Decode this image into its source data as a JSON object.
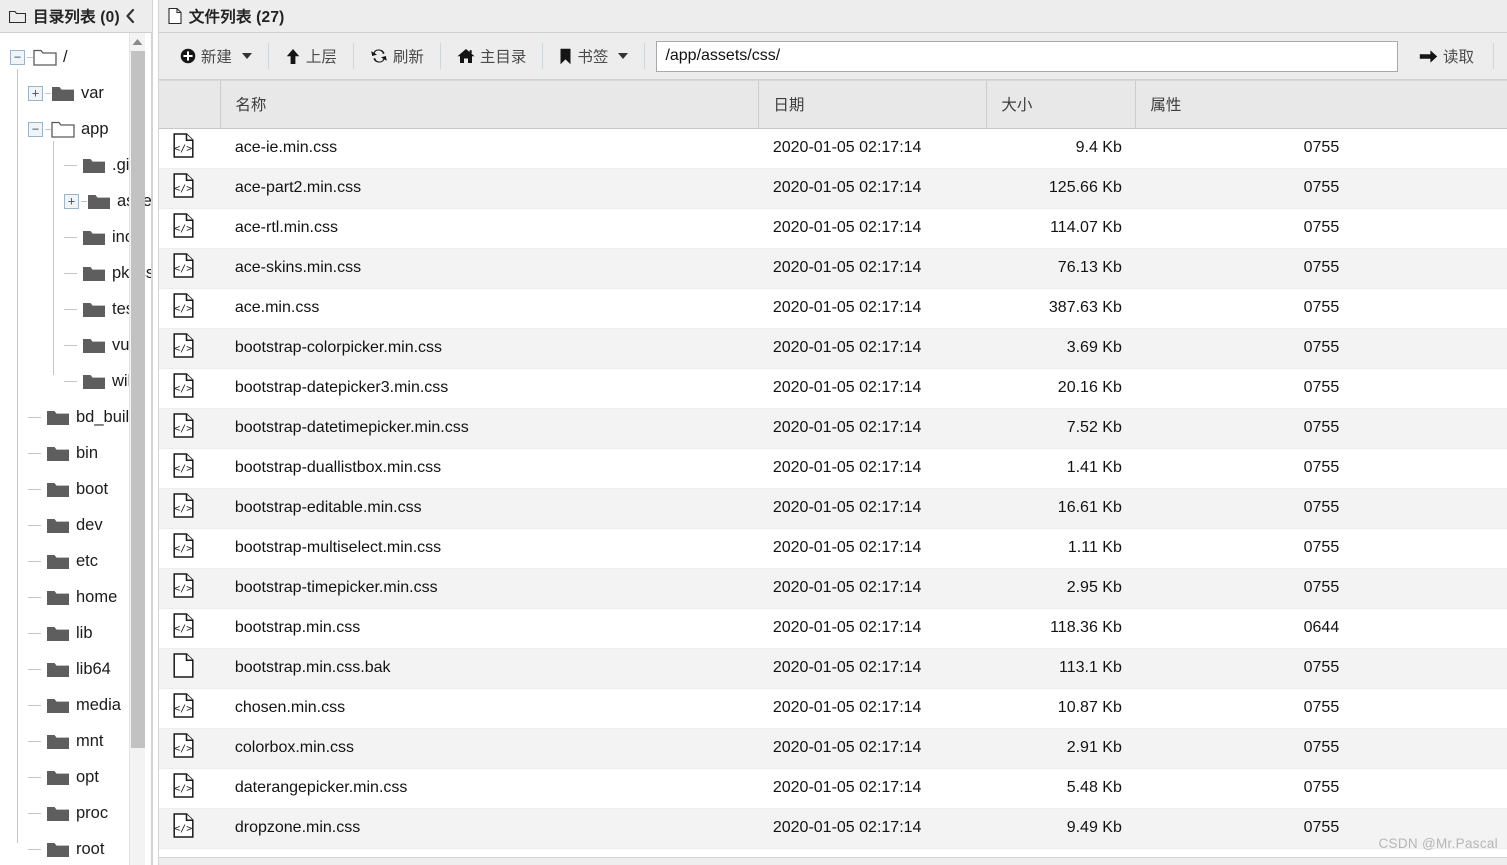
{
  "left_panel": {
    "title": "目录列表 (0)",
    "title_icon": "folder-outline-icon",
    "collapse_icon": "chevron-left-icon",
    "tree": [
      {
        "label": "/",
        "depth": 0,
        "toggle": "minus",
        "folder": "open"
      },
      {
        "label": "var",
        "depth": 1,
        "toggle": "plus",
        "folder": "closed"
      },
      {
        "label": "app",
        "depth": 1,
        "toggle": "minus",
        "folder": "open"
      },
      {
        "label": ".git",
        "depth": 2,
        "toggle": "none",
        "folder": "closed"
      },
      {
        "label": "assets",
        "depth": 2,
        "toggle": "plus",
        "folder": "closed"
      },
      {
        "label": "inc",
        "depth": 2,
        "toggle": "none",
        "folder": "closed"
      },
      {
        "label": "pkxss",
        "depth": 2,
        "toggle": "none",
        "folder": "closed"
      },
      {
        "label": "test",
        "depth": 2,
        "toggle": "none",
        "folder": "closed"
      },
      {
        "label": "vul",
        "depth": 2,
        "toggle": "none",
        "folder": "closed"
      },
      {
        "label": "wiki",
        "depth": 2,
        "toggle": "none",
        "folder": "closed"
      },
      {
        "label": "bd_build",
        "depth": 1,
        "toggle": "none",
        "folder": "closed"
      },
      {
        "label": "bin",
        "depth": 1,
        "toggle": "none",
        "folder": "closed"
      },
      {
        "label": "boot",
        "depth": 1,
        "toggle": "none",
        "folder": "closed"
      },
      {
        "label": "dev",
        "depth": 1,
        "toggle": "none",
        "folder": "closed"
      },
      {
        "label": "etc",
        "depth": 1,
        "toggle": "none",
        "folder": "closed"
      },
      {
        "label": "home",
        "depth": 1,
        "toggle": "none",
        "folder": "closed"
      },
      {
        "label": "lib",
        "depth": 1,
        "toggle": "none",
        "folder": "closed"
      },
      {
        "label": "lib64",
        "depth": 1,
        "toggle": "none",
        "folder": "closed"
      },
      {
        "label": "media",
        "depth": 1,
        "toggle": "none",
        "folder": "closed"
      },
      {
        "label": "mnt",
        "depth": 1,
        "toggle": "none",
        "folder": "closed"
      },
      {
        "label": "opt",
        "depth": 1,
        "toggle": "none",
        "folder": "closed"
      },
      {
        "label": "proc",
        "depth": 1,
        "toggle": "none",
        "folder": "closed"
      },
      {
        "label": "root",
        "depth": 1,
        "toggle": "none",
        "folder": "closed"
      }
    ]
  },
  "right_panel": {
    "title": "文件列表 (27)",
    "title_icon": "file-outline-icon",
    "toolbar": {
      "new_label": "新建",
      "new_icon": "plus-circle-icon",
      "up_label": "上层",
      "up_icon": "arrow-up-icon",
      "refresh_label": "刷新",
      "refresh_icon": "refresh-icon",
      "home_label": "主目录",
      "home_icon": "home-icon",
      "bookmark_label": "书签",
      "bookmark_icon": "bookmark-icon",
      "read_label": "读取",
      "read_icon": "arrow-right-icon"
    },
    "path": {
      "value": "/app/assets/css/",
      "placeholder": "/"
    },
    "columns": {
      "icon": "",
      "name": "名称",
      "date": "日期",
      "size": "大小",
      "attr": "属性"
    },
    "rows": [
      {
        "icon": "code-file-icon",
        "name": "ace-ie.min.css",
        "date": "2020-01-05 02:17:14",
        "size": "9.4 Kb",
        "attr": "0755"
      },
      {
        "icon": "code-file-icon",
        "name": "ace-part2.min.css",
        "date": "2020-01-05 02:17:14",
        "size": "125.66 Kb",
        "attr": "0755"
      },
      {
        "icon": "code-file-icon",
        "name": "ace-rtl.min.css",
        "date": "2020-01-05 02:17:14",
        "size": "114.07 Kb",
        "attr": "0755"
      },
      {
        "icon": "code-file-icon",
        "name": "ace-skins.min.css",
        "date": "2020-01-05 02:17:14",
        "size": "76.13 Kb",
        "attr": "0755"
      },
      {
        "icon": "code-file-icon",
        "name": "ace.min.css",
        "date": "2020-01-05 02:17:14",
        "size": "387.63 Kb",
        "attr": "0755"
      },
      {
        "icon": "code-file-icon",
        "name": "bootstrap-colorpicker.min.css",
        "date": "2020-01-05 02:17:14",
        "size": "3.69 Kb",
        "attr": "0755"
      },
      {
        "icon": "code-file-icon",
        "name": "bootstrap-datepicker3.min.css",
        "date": "2020-01-05 02:17:14",
        "size": "20.16 Kb",
        "attr": "0755"
      },
      {
        "icon": "code-file-icon",
        "name": "bootstrap-datetimepicker.min.css",
        "date": "2020-01-05 02:17:14",
        "size": "7.52 Kb",
        "attr": "0755"
      },
      {
        "icon": "code-file-icon",
        "name": "bootstrap-duallistbox.min.css",
        "date": "2020-01-05 02:17:14",
        "size": "1.41 Kb",
        "attr": "0755"
      },
      {
        "icon": "code-file-icon",
        "name": "bootstrap-editable.min.css",
        "date": "2020-01-05 02:17:14",
        "size": "16.61 Kb",
        "attr": "0755"
      },
      {
        "icon": "code-file-icon",
        "name": "bootstrap-multiselect.min.css",
        "date": "2020-01-05 02:17:14",
        "size": "1.11 Kb",
        "attr": "0755"
      },
      {
        "icon": "code-file-icon",
        "name": "bootstrap-timepicker.min.css",
        "date": "2020-01-05 02:17:14",
        "size": "2.95 Kb",
        "attr": "0755"
      },
      {
        "icon": "code-file-icon",
        "name": "bootstrap.min.css",
        "date": "2020-01-05 02:17:14",
        "size": "118.36 Kb",
        "attr": "0644"
      },
      {
        "icon": "blank-file-icon",
        "name": "bootstrap.min.css.bak",
        "date": "2020-01-05 02:17:14",
        "size": "113.1 Kb",
        "attr": "0755"
      },
      {
        "icon": "code-file-icon",
        "name": "chosen.min.css",
        "date": "2020-01-05 02:17:14",
        "size": "10.87 Kb",
        "attr": "0755"
      },
      {
        "icon": "code-file-icon",
        "name": "colorbox.min.css",
        "date": "2020-01-05 02:17:14",
        "size": "2.91 Kb",
        "attr": "0755"
      },
      {
        "icon": "code-file-icon",
        "name": "daterangepicker.min.css",
        "date": "2020-01-05 02:17:14",
        "size": "5.48 Kb",
        "attr": "0755"
      },
      {
        "icon": "code-file-icon",
        "name": "dropzone.min.css",
        "date": "2020-01-05 02:17:14",
        "size": "9.49 Kb",
        "attr": "0755"
      }
    ]
  },
  "watermark": "CSDN @Mr.Pascal"
}
